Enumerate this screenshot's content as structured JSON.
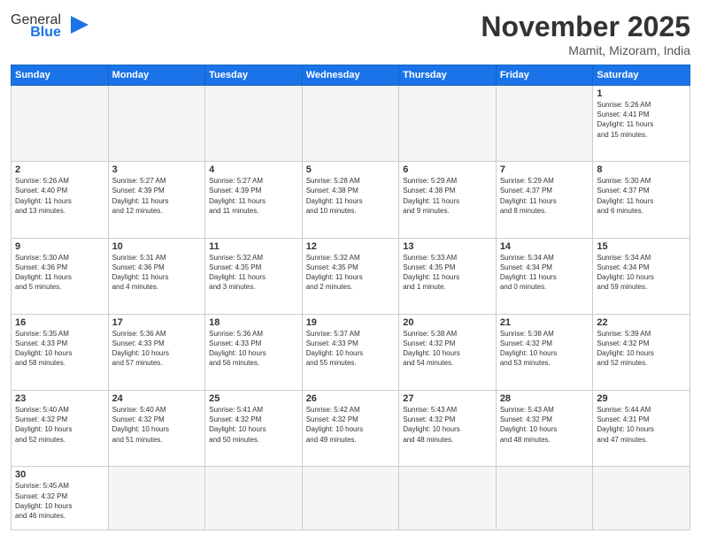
{
  "header": {
    "logo_general": "General",
    "logo_blue": "Blue",
    "title": "November 2025",
    "location": "Mamit, Mizoram, India"
  },
  "days_of_week": [
    "Sunday",
    "Monday",
    "Tuesday",
    "Wednesday",
    "Thursday",
    "Friday",
    "Saturday"
  ],
  "weeks": [
    [
      {
        "day": "",
        "info": ""
      },
      {
        "day": "",
        "info": ""
      },
      {
        "day": "",
        "info": ""
      },
      {
        "day": "",
        "info": ""
      },
      {
        "day": "",
        "info": ""
      },
      {
        "day": "",
        "info": ""
      },
      {
        "day": "1",
        "info": "Sunrise: 5:26 AM\nSunset: 4:41 PM\nDaylight: 11 hours\nand 15 minutes."
      }
    ],
    [
      {
        "day": "2",
        "info": "Sunrise: 5:26 AM\nSunset: 4:40 PM\nDaylight: 11 hours\nand 13 minutes."
      },
      {
        "day": "3",
        "info": "Sunrise: 5:27 AM\nSunset: 4:39 PM\nDaylight: 11 hours\nand 12 minutes."
      },
      {
        "day": "4",
        "info": "Sunrise: 5:27 AM\nSunset: 4:39 PM\nDaylight: 11 hours\nand 11 minutes."
      },
      {
        "day": "5",
        "info": "Sunrise: 5:28 AM\nSunset: 4:38 PM\nDaylight: 11 hours\nand 10 minutes."
      },
      {
        "day": "6",
        "info": "Sunrise: 5:29 AM\nSunset: 4:38 PM\nDaylight: 11 hours\nand 9 minutes."
      },
      {
        "day": "7",
        "info": "Sunrise: 5:29 AM\nSunset: 4:37 PM\nDaylight: 11 hours\nand 8 minutes."
      },
      {
        "day": "8",
        "info": "Sunrise: 5:30 AM\nSunset: 4:37 PM\nDaylight: 11 hours\nand 6 minutes."
      }
    ],
    [
      {
        "day": "9",
        "info": "Sunrise: 5:30 AM\nSunset: 4:36 PM\nDaylight: 11 hours\nand 5 minutes."
      },
      {
        "day": "10",
        "info": "Sunrise: 5:31 AM\nSunset: 4:36 PM\nDaylight: 11 hours\nand 4 minutes."
      },
      {
        "day": "11",
        "info": "Sunrise: 5:32 AM\nSunset: 4:35 PM\nDaylight: 11 hours\nand 3 minutes."
      },
      {
        "day": "12",
        "info": "Sunrise: 5:32 AM\nSunset: 4:35 PM\nDaylight: 11 hours\nand 2 minutes."
      },
      {
        "day": "13",
        "info": "Sunrise: 5:33 AM\nSunset: 4:35 PM\nDaylight: 11 hours\nand 1 minute."
      },
      {
        "day": "14",
        "info": "Sunrise: 5:34 AM\nSunset: 4:34 PM\nDaylight: 11 hours\nand 0 minutes."
      },
      {
        "day": "15",
        "info": "Sunrise: 5:34 AM\nSunset: 4:34 PM\nDaylight: 10 hours\nand 59 minutes."
      }
    ],
    [
      {
        "day": "16",
        "info": "Sunrise: 5:35 AM\nSunset: 4:33 PM\nDaylight: 10 hours\nand 58 minutes."
      },
      {
        "day": "17",
        "info": "Sunrise: 5:36 AM\nSunset: 4:33 PM\nDaylight: 10 hours\nand 57 minutes."
      },
      {
        "day": "18",
        "info": "Sunrise: 5:36 AM\nSunset: 4:33 PM\nDaylight: 10 hours\nand 56 minutes."
      },
      {
        "day": "19",
        "info": "Sunrise: 5:37 AM\nSunset: 4:33 PM\nDaylight: 10 hours\nand 55 minutes."
      },
      {
        "day": "20",
        "info": "Sunrise: 5:38 AM\nSunset: 4:32 PM\nDaylight: 10 hours\nand 54 minutes."
      },
      {
        "day": "21",
        "info": "Sunrise: 5:38 AM\nSunset: 4:32 PM\nDaylight: 10 hours\nand 53 minutes."
      },
      {
        "day": "22",
        "info": "Sunrise: 5:39 AM\nSunset: 4:32 PM\nDaylight: 10 hours\nand 52 minutes."
      }
    ],
    [
      {
        "day": "23",
        "info": "Sunrise: 5:40 AM\nSunset: 4:32 PM\nDaylight: 10 hours\nand 52 minutes."
      },
      {
        "day": "24",
        "info": "Sunrise: 5:40 AM\nSunset: 4:32 PM\nDaylight: 10 hours\nand 51 minutes."
      },
      {
        "day": "25",
        "info": "Sunrise: 5:41 AM\nSunset: 4:32 PM\nDaylight: 10 hours\nand 50 minutes."
      },
      {
        "day": "26",
        "info": "Sunrise: 5:42 AM\nSunset: 4:32 PM\nDaylight: 10 hours\nand 49 minutes."
      },
      {
        "day": "27",
        "info": "Sunrise: 5:43 AM\nSunset: 4:32 PM\nDaylight: 10 hours\nand 48 minutes."
      },
      {
        "day": "28",
        "info": "Sunrise: 5:43 AM\nSunset: 4:32 PM\nDaylight: 10 hours\nand 48 minutes."
      },
      {
        "day": "29",
        "info": "Sunrise: 5:44 AM\nSunset: 4:31 PM\nDaylight: 10 hours\nand 47 minutes."
      }
    ],
    [
      {
        "day": "30",
        "info": "Sunrise: 5:45 AM\nSunset: 4:32 PM\nDaylight: 10 hours\nand 46 minutes."
      },
      {
        "day": "",
        "info": ""
      },
      {
        "day": "",
        "info": ""
      },
      {
        "day": "",
        "info": ""
      },
      {
        "day": "",
        "info": ""
      },
      {
        "day": "",
        "info": ""
      },
      {
        "day": "",
        "info": ""
      }
    ]
  ]
}
